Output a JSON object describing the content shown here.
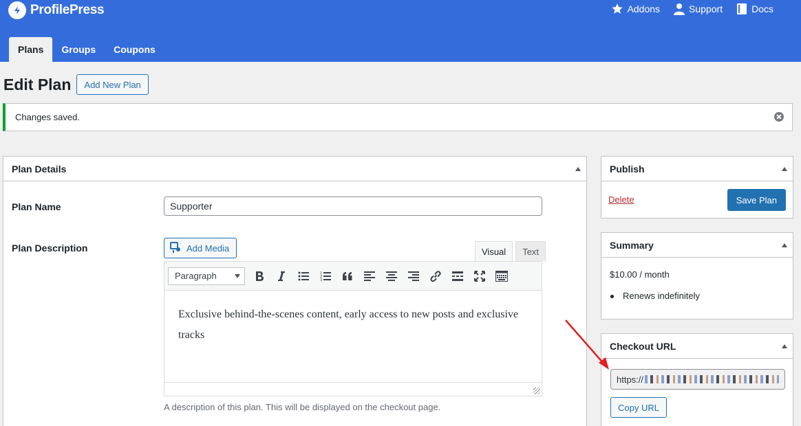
{
  "brand": {
    "name": "ProfilePress"
  },
  "top_links": [
    {
      "label": "Addons",
      "icon": "star-icon"
    },
    {
      "label": "Support",
      "icon": "user-icon"
    },
    {
      "label": "Docs",
      "icon": "book-icon"
    }
  ],
  "tabs": [
    {
      "label": "Plans",
      "active": true
    },
    {
      "label": "Groups",
      "active": false
    },
    {
      "label": "Coupons",
      "active": false
    }
  ],
  "page": {
    "title": "Edit Plan",
    "add_new_label": "Add New Plan"
  },
  "notice": {
    "text": "Changes saved.",
    "color": "#00a32a"
  },
  "plan_details": {
    "title": "Plan Details",
    "name_label": "Plan Name",
    "name_value": "Supporter",
    "description_label": "Plan Description",
    "add_media_label": "Add Media",
    "editor_tabs": [
      "Visual",
      "Text"
    ],
    "format_value": "Paragraph",
    "toolbar_icons": [
      "bold-icon",
      "italic-icon",
      "bullet-list-icon",
      "numbered-list-icon",
      "blockquote-icon",
      "align-left-icon",
      "align-center-icon",
      "align-right-icon",
      "link-icon",
      "read-more-icon",
      "fullscreen-icon",
      "toolbar-toggle-icon"
    ],
    "description_text": "Exclusive behind-the-scenes content, early access to new posts and exclusive tracks",
    "help_text": "A description of this plan. This will be displayed on the checkout page."
  },
  "publish": {
    "title": "Publish",
    "delete_label": "Delete",
    "save_label": "Save Plan"
  },
  "summary": {
    "title": "Summary",
    "price": "$10.00 / month",
    "renewal": "Renews indefinitely"
  },
  "checkout": {
    "title": "Checkout URL",
    "url_prefix": "https://",
    "copy_label": "Copy URL"
  },
  "colors": {
    "header": "#346ddb",
    "accent": "#2271b1",
    "danger": "#b32d2e",
    "annotation": "#e0201c"
  }
}
